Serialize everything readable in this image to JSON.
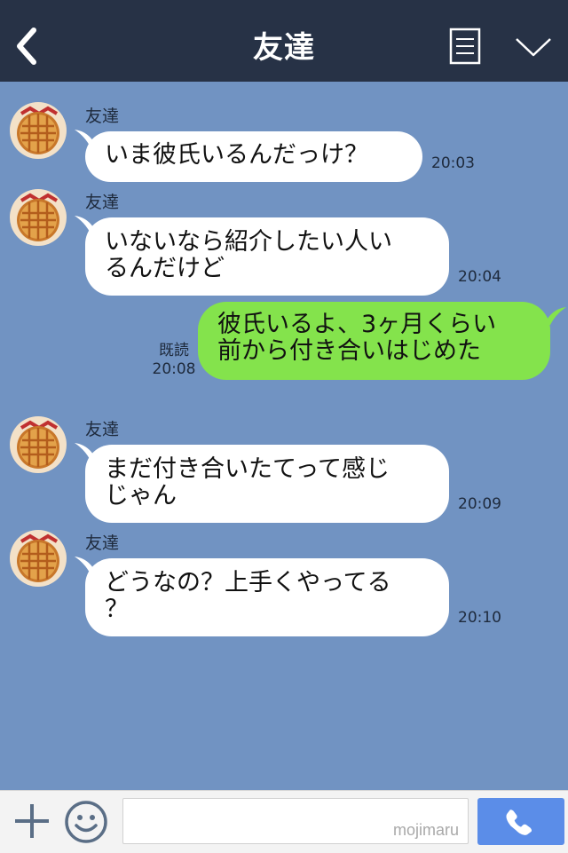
{
  "header": {
    "title": "友達"
  },
  "icons": {
    "back": "chevron-left-icon",
    "menu": "menu-list-icon",
    "collapse": "chevron-down-icon",
    "plus": "plus-icon",
    "emoji": "smiley-icon",
    "call": "phone-icon"
  },
  "colors": {
    "header_bg": "#273246",
    "chat_bg": "#7193c2",
    "incoming_bubble": "#ffffff",
    "outgoing_bubble": "#84e34c",
    "call_button": "#5b8de8"
  },
  "messages": [
    {
      "direction": "in",
      "sender": "友達",
      "text": "いま彼氏いるんだっけ？",
      "time": "20:03"
    },
    {
      "direction": "in",
      "sender": "友達",
      "text": "いないなら紹介したい人い\nるんだけど",
      "time": "20:04"
    },
    {
      "direction": "out",
      "text": "彼氏いるよ、3ヶ月くらい\n前から付き合いはじめた",
      "read": "既読",
      "time": "20:08"
    },
    {
      "direction": "in",
      "sender": "友達",
      "text": "まだ付き合いたてって感じ\nじゃん",
      "time": "20:09"
    },
    {
      "direction": "in",
      "sender": "友達",
      "text": "どうなの？上手くやってる\n？",
      "time": "20:10"
    }
  ],
  "footer": {
    "input_value": "",
    "watermark": "mojimaru"
  }
}
